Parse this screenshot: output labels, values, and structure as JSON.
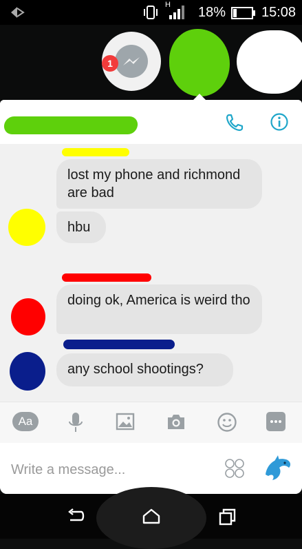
{
  "status_bar": {
    "network_label": "H",
    "battery_percent": "18%",
    "time": "15:08"
  },
  "chat_heads": {
    "unread_badge": "1"
  },
  "thread": {
    "messages": [
      {
        "text": "lost my phone and richmond are bad"
      },
      {
        "text": "hbu"
      },
      {
        "text": "doing ok, America is weird tho"
      },
      {
        "text": "any school shootings?"
      }
    ]
  },
  "toolbar": {
    "text_button_label": "Aa"
  },
  "composer": {
    "placeholder": "Write a message..."
  },
  "colors": {
    "accent": "#1fa6c9",
    "bubble": "#e4e4e4",
    "redaction_green": "#5ed00c",
    "redaction_yellow": "#ffff00",
    "redaction_red": "#ff0000",
    "redaction_blue": "#0a1e8c"
  }
}
